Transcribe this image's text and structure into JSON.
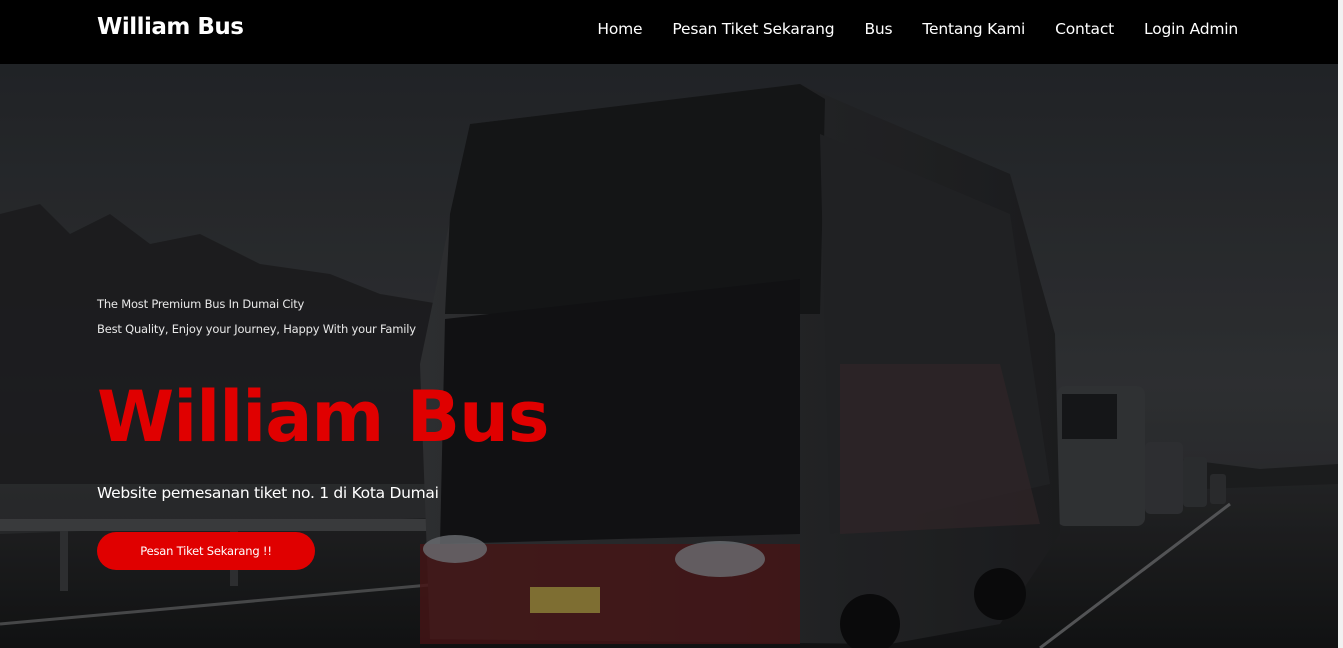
{
  "brand": "William Bus",
  "nav": {
    "items": [
      {
        "label": "Home"
      },
      {
        "label": "Pesan Tiket Sekarang"
      },
      {
        "label": "Bus"
      },
      {
        "label": "Tentang Kami"
      },
      {
        "label": "Contact"
      },
      {
        "label": "Login Admin"
      }
    ]
  },
  "hero": {
    "tagline_1": "The Most Premium Bus In Dumai City",
    "tagline_2": "Best Quality, Enjoy your Journey, Happy With your Family",
    "title": "William Bus",
    "subtitle": "Website pemesanan tiket no. 1 di Kota Dumai",
    "cta_label": "Pesan Tiket Sekarang !!",
    "background_image": "double-decker-bus-photo",
    "accent_color": "#e00000"
  },
  "colors": {
    "navbar_bg": "#000000",
    "text": "#ffffff",
    "accent": "#e00000"
  }
}
